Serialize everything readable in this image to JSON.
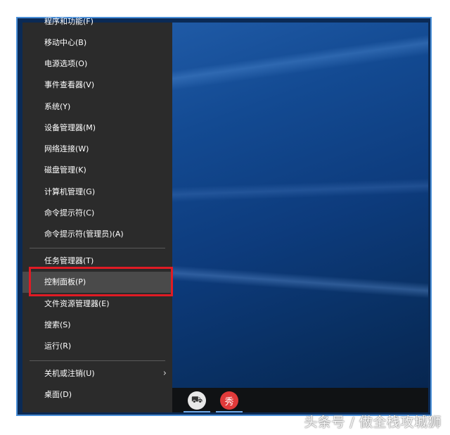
{
  "menu": {
    "items": [
      {
        "label": "程序和功能(F)"
      },
      {
        "label": "移动中心(B)"
      },
      {
        "label": "电源选项(O)"
      },
      {
        "label": "事件查看器(V)"
      },
      {
        "label": "系统(Y)"
      },
      {
        "label": "设备管理器(M)"
      },
      {
        "label": "网络连接(W)"
      },
      {
        "label": "磁盘管理(K)"
      },
      {
        "label": "计算机管理(G)"
      },
      {
        "label": "命令提示符(C)"
      },
      {
        "label": "命令提示符(管理员)(A)"
      },
      {
        "label": "任务管理器(T)"
      },
      {
        "label": "控制面板(P)"
      },
      {
        "label": "文件资源管理器(E)"
      },
      {
        "label": "搜索(S)"
      },
      {
        "label": "运行(R)"
      },
      {
        "label": "关机或注销(U)"
      },
      {
        "label": "桌面(D)"
      }
    ],
    "highlighted_item": "控制面板(P)",
    "submenu_arrow": "›"
  },
  "taskbar": {
    "icons": [
      {
        "name": "app-icon",
        "glyph": "⛟"
      },
      {
        "name": "app-icon-red",
        "glyph": "秀"
      }
    ]
  },
  "watermark": "头条号 / 做全栈攻城狮",
  "colors": {
    "menu_bg": "#2b2b2b",
    "highlight_border": "#e01b24",
    "frame_border": "#4a8fd8"
  }
}
